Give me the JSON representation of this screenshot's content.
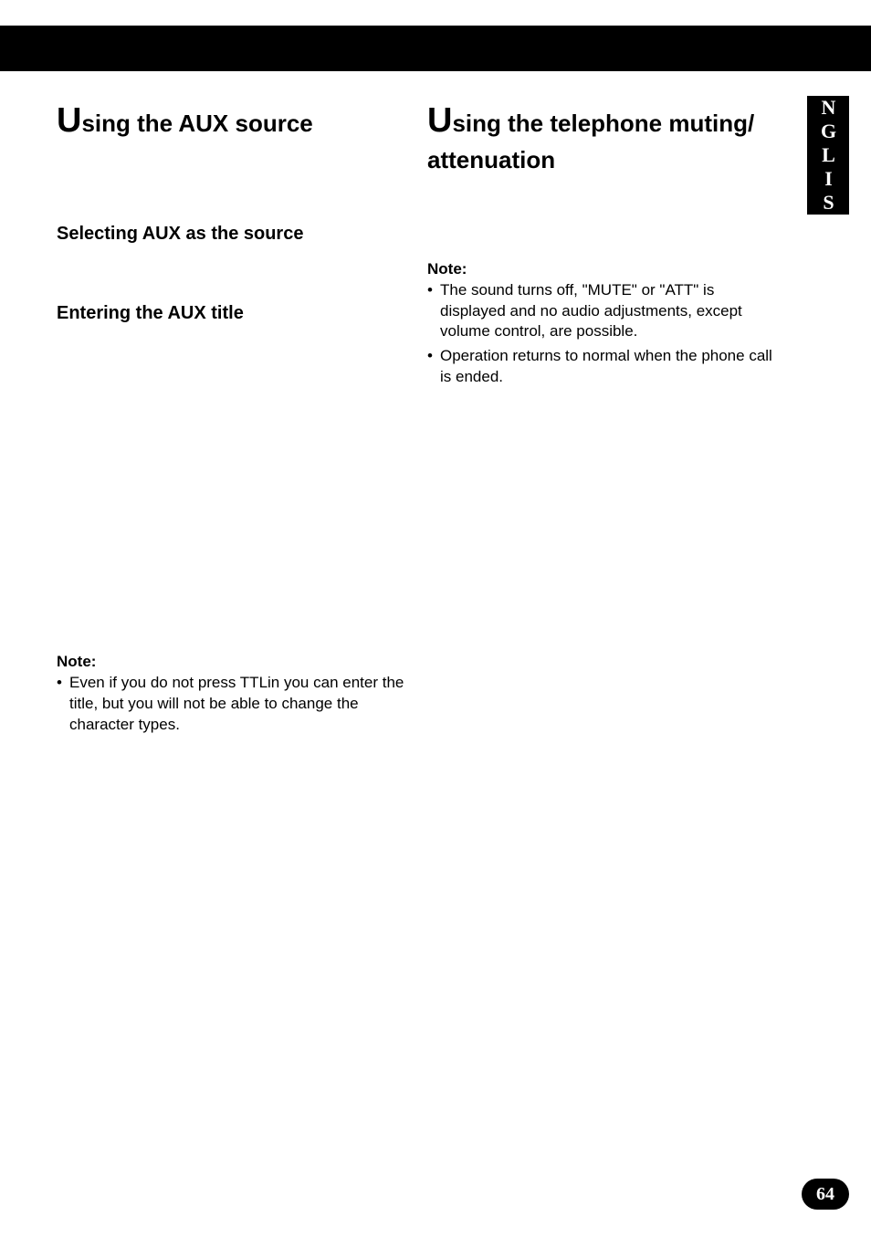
{
  "sidetab": {
    "label": "ENGLISH"
  },
  "left": {
    "title_big": "U",
    "title_rest": "sing the AUX source",
    "sub1": "Selecting AUX as the source",
    "sub2": "Entering the AUX title",
    "note_label": "Note:",
    "note_items": [
      "Even if you do not press TTLin you can enter the title, but you will not be able to change the character types."
    ]
  },
  "right": {
    "title_big": "U",
    "title_rest_line1": "sing the telephone muting/",
    "title_rest_line2": "attenuation",
    "note_label": "Note:",
    "note_items": [
      "The sound turns off, \"MUTE\" or \"ATT\" is displayed and no audio adjustments, except volume control, are possible.",
      "Operation returns to normal when the phone call is ended."
    ]
  },
  "page_number": "64"
}
